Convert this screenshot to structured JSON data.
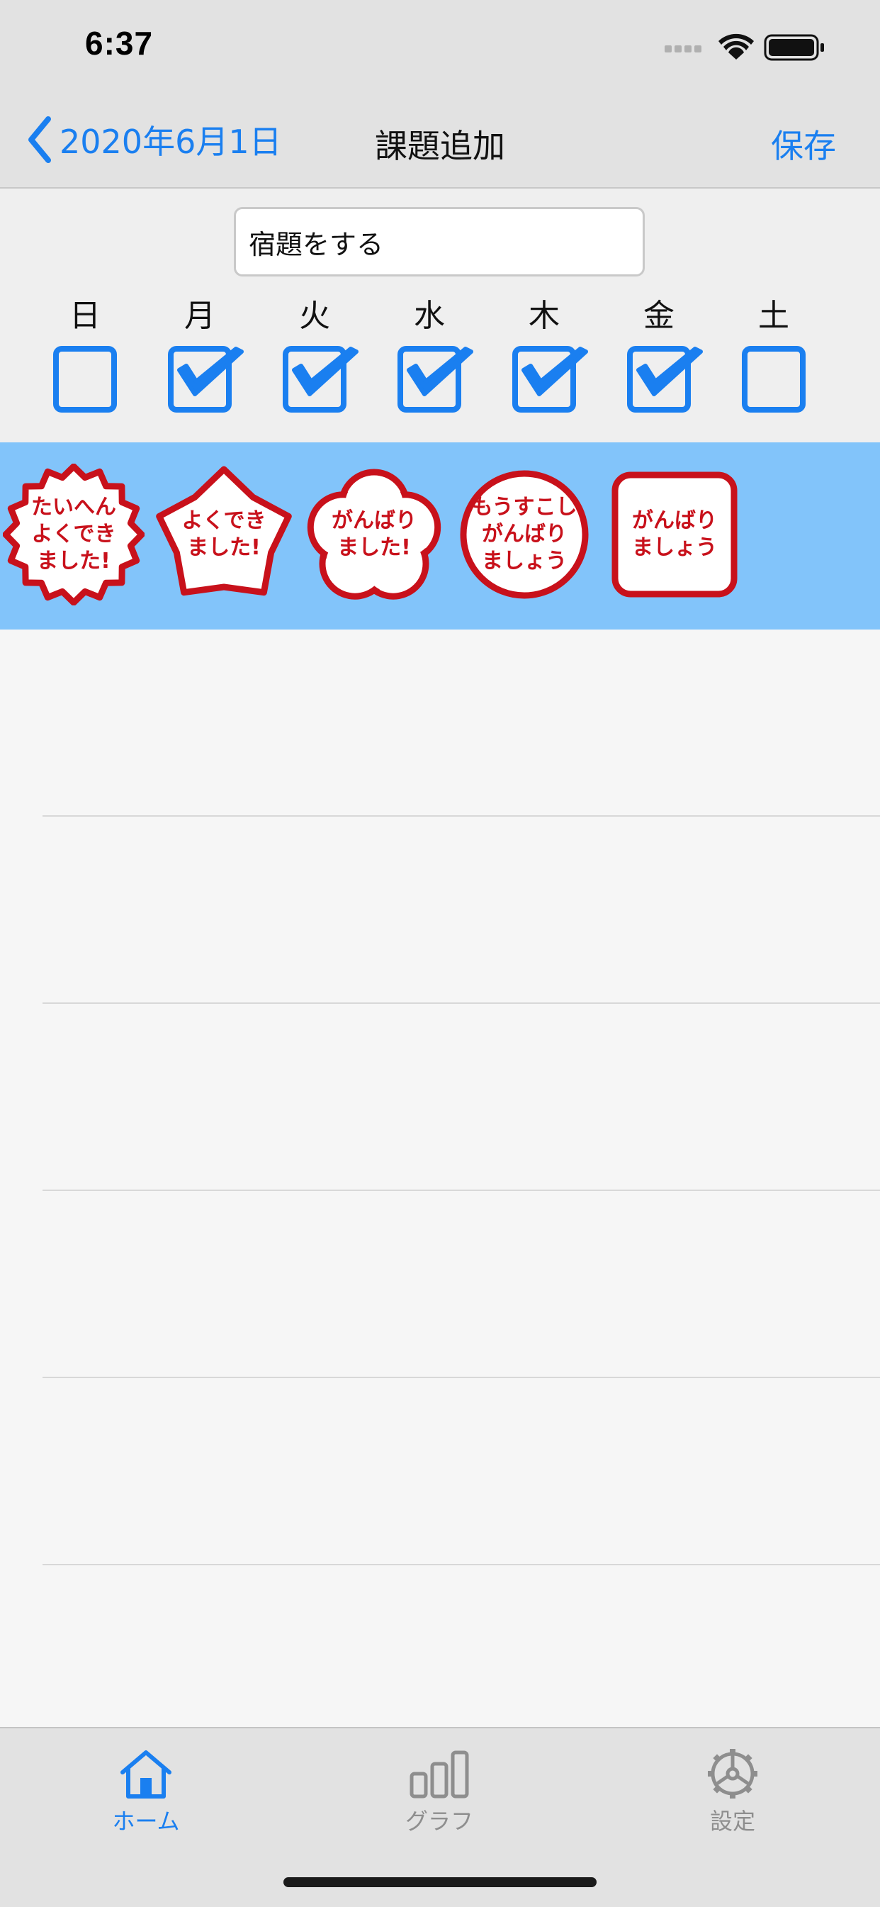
{
  "status": {
    "time": "6:37"
  },
  "nav": {
    "back_label": "2020年6月1日",
    "title": "課題追加",
    "save_label": "保存"
  },
  "task": {
    "value": "宿題をする"
  },
  "days": [
    {
      "label": "日",
      "checked": false
    },
    {
      "label": "月",
      "checked": true
    },
    {
      "label": "火",
      "checked": true
    },
    {
      "label": "水",
      "checked": true
    },
    {
      "label": "木",
      "checked": true
    },
    {
      "label": "金",
      "checked": true
    },
    {
      "label": "土",
      "checked": false
    }
  ],
  "stamps": [
    {
      "lines": [
        "たいへん",
        "よくでき",
        "ました!"
      ],
      "shape": "burst"
    },
    {
      "lines": [
        "よくでき",
        "ました!"
      ],
      "shape": "star"
    },
    {
      "lines": [
        "がんばり",
        "ました!"
      ],
      "shape": "flower"
    },
    {
      "lines": [
        "もうすこし",
        "がんばり",
        "ましょう"
      ],
      "shape": "circle"
    },
    {
      "lines": [
        "がんばり",
        "ましょう"
      ],
      "shape": "square"
    }
  ],
  "tabs": [
    {
      "label": "ホーム",
      "icon": "home-icon",
      "active": true
    },
    {
      "label": "グラフ",
      "icon": "bar-chart-icon",
      "active": false
    },
    {
      "label": "設定",
      "icon": "gear-icon",
      "active": false
    }
  ],
  "colors": {
    "accent": "#1a7ff0",
    "stamp_red": "#c8111b",
    "stamp_strip": "#82c4fa"
  }
}
